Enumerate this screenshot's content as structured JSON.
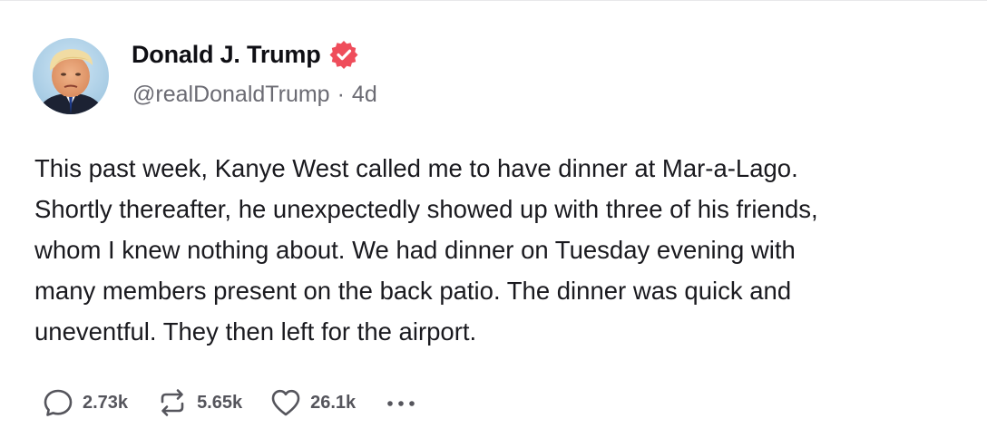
{
  "author": {
    "display_name": "Donald J. Trump",
    "handle": "@realDonaldTrump",
    "separator": "·",
    "time_ago": "4d",
    "verified_badge_color": "#ef4d5b"
  },
  "post": {
    "text": "This past week, Kanye West called me to have dinner at Mar-a-Lago.\nShortly thereafter, he unexpectedly showed up with three of his friends,\nwhom I knew nothing about. We had dinner on Tuesday evening with\nmany members present on the back patio. The dinner was quick and\nuneventful. They then left for the airport."
  },
  "actions": {
    "replies": {
      "icon": "reply-icon",
      "count": "2.73k"
    },
    "restates": {
      "icon": "restate-icon",
      "count": "5.65k"
    },
    "likes": {
      "icon": "heart-icon",
      "count": "26.1k"
    },
    "more": {
      "icon": "more-icon"
    }
  }
}
